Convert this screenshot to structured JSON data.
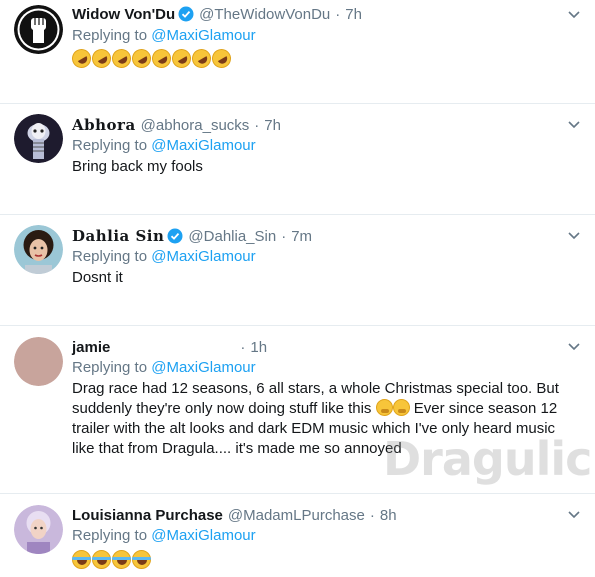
{
  "tweets": [
    {
      "name": "Widow Von'Du",
      "handle": "@TheWidowVonDu",
      "time": "7h",
      "reply_prefix": "Replying to",
      "reply_to": "@MaxiGlamour",
      "text": "",
      "emoji_count": 8
    },
    {
      "name": "Abhora",
      "handle": "@abhora_sucks",
      "time": "7h",
      "reply_prefix": "Replying to",
      "reply_to": "@MaxiGlamour",
      "text": "Bring back my fools"
    },
    {
      "name": "Dahlia Sin",
      "handle": "@Dahlia_Sin",
      "time": "7m",
      "reply_prefix": "Replying to",
      "reply_to": "@MaxiGlamour",
      "text": "Dosnt it"
    },
    {
      "name": "jamie",
      "handle": "",
      "time": "1h",
      "reply_prefix": "Replying to",
      "reply_to": "@MaxiGlamour",
      "line1": "Drag race had 12 seasons, 6 all stars, a whole Christmas special too. But",
      "line2": "suddenly they're only now doing stuff like this",
      "line3": "Ever since season 12",
      "line4": "trailer with the alt looks and dark EDM music which I've only heard music",
      "line5": "like that from Dragula.... it's made me so annoyed"
    },
    {
      "name": "Louisianna Purchase",
      "handle": "@MadamLPurchase",
      "time": "8h",
      "reply_prefix": "Replying to",
      "reply_to": "@MaxiGlamour",
      "emoji_count": 4
    }
  ],
  "watermark": "Dragulicious",
  "colors": {
    "link": "#1da1f2",
    "muted": "#657786",
    "text": "#14171a",
    "divider": "#e6ecf0",
    "verified": "#1da1f2"
  },
  "icons": {
    "caret": "chevron-down-icon",
    "verified": "verified-badge-icon",
    "fist": "raised-fist-icon"
  }
}
